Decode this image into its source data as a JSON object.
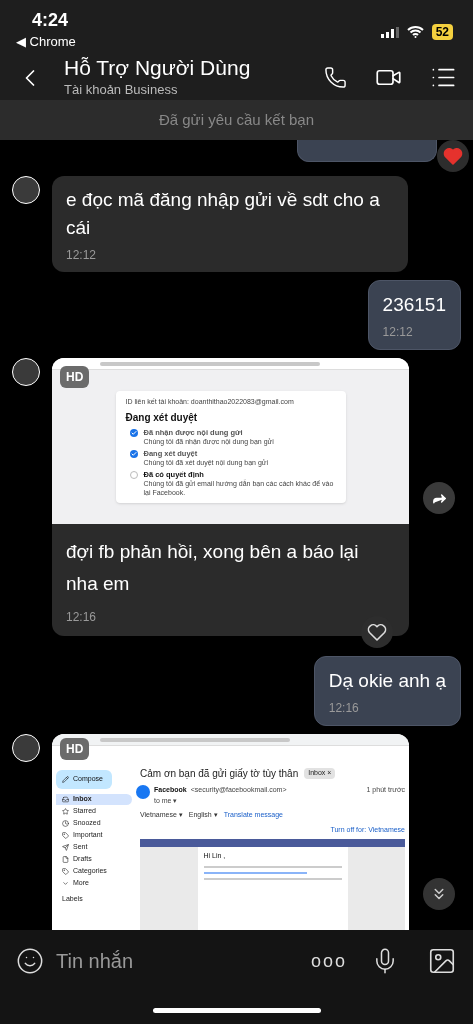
{
  "status_bar": {
    "time": "4:24",
    "back_app": "◀ Chrome",
    "battery": "52"
  },
  "header": {
    "title": "Hỗ Trợ Người Dùng",
    "subtitle": "Tài khoản Business"
  },
  "banner": "Đã gửi yêu cầu kết bạn",
  "messages": [
    {
      "kind": "partial",
      "liked": true
    },
    {
      "kind": "text",
      "outgoing": false,
      "text": "e đọc mã đăng nhập gửi về sdt cho a cái",
      "time": "12:12"
    },
    {
      "kind": "text",
      "outgoing": true,
      "text": "236151",
      "time": "12:12"
    },
    {
      "kind": "review",
      "badge": "HD",
      "card": {
        "account": "ID liên kết tài khoản: doanthithao2022083@gmail.com",
        "title": "Đang xét duyệt",
        "steps": [
          {
            "label": "Đã nhận được nội dung gửi",
            "note": "Chúng tôi đã nhận được nội dung bạn gửi",
            "checked": true
          },
          {
            "label": "Đang xét duyệt",
            "note": "Chúng tôi đã xét duyệt nội dung bạn gửi",
            "checked": true
          },
          {
            "label": "Đã có quyết định",
            "note": "Chúng tôi đã gửi email hướng dẫn bạn các cách khác để vào lại Facebook.",
            "checked": false
          }
        ]
      },
      "text": "đợi fb phản hồi, xong bên a báo lại nha em",
      "time": "12:16",
      "liked": false
    },
    {
      "kind": "text",
      "outgoing": true,
      "text": "Dạ okie anh ạ",
      "time": "12:16"
    },
    {
      "kind": "mail",
      "badge": "HD",
      "mail": {
        "compose": "Compose",
        "folders": [
          {
            "label": "Inbox",
            "selected": true
          },
          {
            "label": "Starred",
            "selected": false
          },
          {
            "label": "Snoozed",
            "selected": false
          },
          {
            "label": "Important",
            "selected": false
          },
          {
            "label": "Sent",
            "selected": false
          },
          {
            "label": "Drafts",
            "selected": false
          },
          {
            "label": "Categories",
            "selected": false
          },
          {
            "label": "More",
            "selected": false
          }
        ],
        "labels": "Labels",
        "subject": "Cảm ơn bạn đã gửi giấy tờ tùy thân",
        "tag": "Inbox ×",
        "sender": "Facebook",
        "sender_email": "<security@facebookmail.com>",
        "to": "to me ▾",
        "ago": "1 phút trước",
        "lang_from": "Vietnamese ▾",
        "lang_to": "English ▾",
        "translate": "Translate message",
        "turn_off": "Turn off for: Vietnamese",
        "greeting": "Hi Lin ,"
      }
    }
  ],
  "input": {
    "placeholder": "Tin nhắn",
    "more": "ooo"
  }
}
